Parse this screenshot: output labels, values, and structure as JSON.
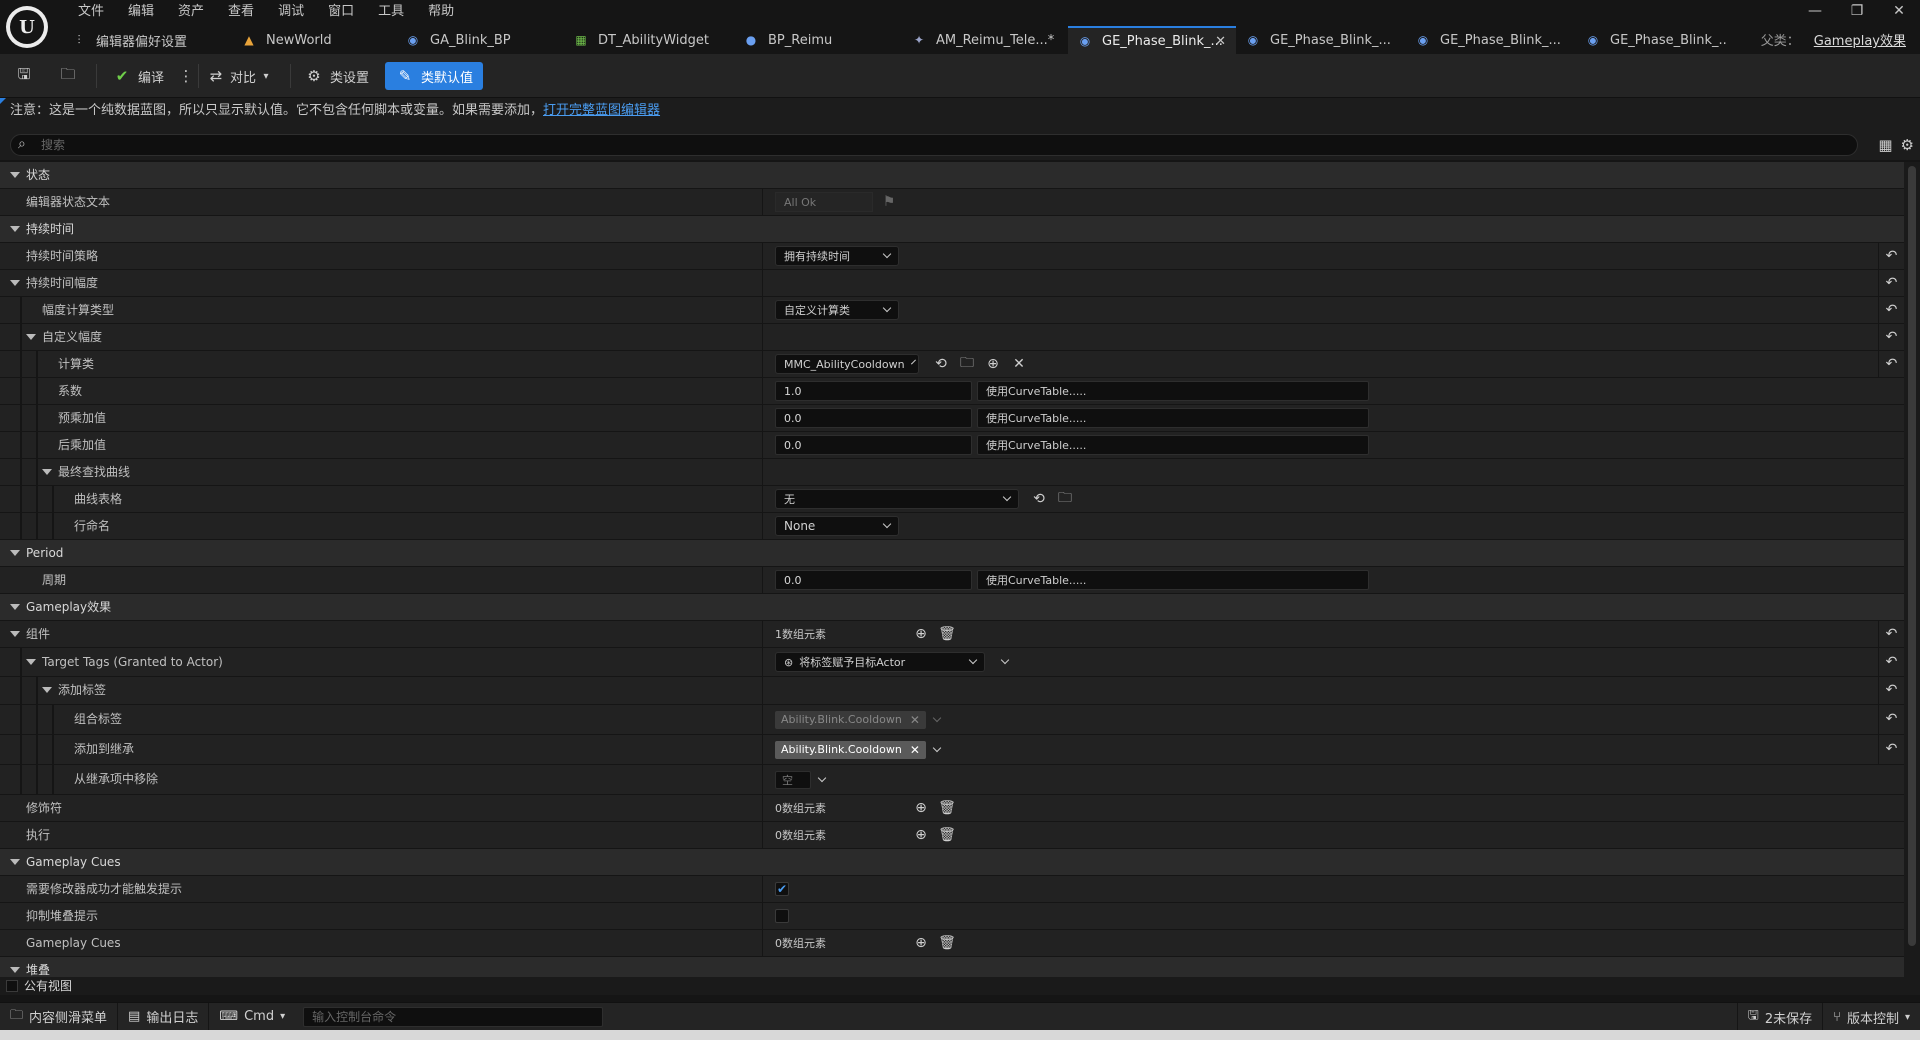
{
  "menu": [
    "文件",
    "编辑",
    "资产",
    "查看",
    "调试",
    "窗口",
    "工具",
    "帮助"
  ],
  "window_controls": [
    "—",
    "❐",
    "✕"
  ],
  "tabs": [
    {
      "label": "编辑器偏好设置",
      "icon": "sliders-icon",
      "glyph": "⫶"
    },
    {
      "label": "NewWorld",
      "icon": "level-icon",
      "glyph": "▲"
    },
    {
      "label": "GA_Blink_BP",
      "icon": "blueprint-icon",
      "glyph": "◉"
    },
    {
      "label": "DT_AbilityWidget",
      "icon": "datatable-icon",
      "glyph": "▦"
    },
    {
      "label": "BP_Reimu",
      "icon": "character-icon",
      "glyph": "●"
    },
    {
      "label": "AM_Reimu_Tele...*",
      "icon": "montage-icon",
      "glyph": "✦"
    },
    {
      "label": "GE_Phase_Blink_...",
      "icon": "blueprint-icon",
      "glyph": "◉",
      "active": true
    },
    {
      "label": "GE_Phase_Blink_...",
      "icon": "blueprint-icon",
      "glyph": "◉"
    },
    {
      "label": "GE_Phase_Blink_...",
      "icon": "blueprint-icon",
      "glyph": "◉"
    },
    {
      "label": "GE_Phase_Blink_...",
      "icon": "blueprint-icon",
      "glyph": "◉"
    }
  ],
  "tab_close": "✕",
  "parent_class": {
    "label": "父类：",
    "value": "Gameplay效果"
  },
  "toolbar": {
    "compile": "编译",
    "diff": "对比",
    "class_settings": "类设置",
    "class_defaults": "类默认值"
  },
  "notice": {
    "text": "注意：这是一个纯数据蓝图，所以只显示默认值。它不包含任何脚本或变量。如果需要添加，",
    "link": "打开完整蓝图编辑器"
  },
  "search": {
    "placeholder": "搜索"
  },
  "rows": {
    "status_cat": "状态",
    "editor_status_text": "编辑器状态文本",
    "editor_status_value": "All Ok",
    "duration_cat": "持续时间",
    "duration_policy": "持续时间策略",
    "duration_policy_value": "拥有持续时间",
    "duration_magnitude": "持续时间幅度",
    "magnitude_calc_type": "幅度计算类型",
    "magnitude_calc_value": "自定义计算类",
    "custom_magnitude": "自定义幅度",
    "calc_class": "计算类",
    "calc_class_value": "MMC_AbilityCooldown",
    "coefficient": "系数",
    "coefficient_value": "1.0",
    "pre_mult": "预乘加值",
    "pre_mult_value": "0.0",
    "post_mult": "后乘加值",
    "post_mult_value": "0.0",
    "curve_option": "使用CurveTable.....",
    "final_lookup": "最终查找曲线",
    "curve_table": "曲线表格",
    "curve_table_value": "无",
    "row_name": "行命名",
    "row_name_value": "None",
    "period_cat": "Period",
    "period": "周期",
    "period_value": "0.0",
    "ge_cat": "Gameplay效果",
    "components": "组件",
    "components_value": "1数组元素",
    "target_tags": "Target Tags (Granted to Actor)",
    "target_tags_value": "将标签赋予目标Actor",
    "add_tags": "添加标签",
    "combined_tags": "组合标签",
    "combined_tags_value": "Ability.Blink.Cooldown",
    "added": "添加到继承",
    "added_value": "Ability.Blink.Cooldown",
    "removed": "从继承项中移除",
    "removed_value": "空",
    "modifiers": "修饰符",
    "modifiers_value": "0数组元素",
    "executions": "执行",
    "executions_value": "0数组元素",
    "cues_cat": "Gameplay Cues",
    "require_modifier": "需要修改器成功才能触发提示",
    "suppress_stacking": "抑制堆叠提示",
    "gameplay_cues": "Gameplay Cues",
    "gameplay_cues_value": "0数组元素",
    "stacking_cat": "堆叠"
  },
  "public_view": "公有视图",
  "bottombar": {
    "content_drawer": "内容侧滑菜单",
    "output_log": "输出日志",
    "cmd": "Cmd",
    "console_placeholder": "输入控制台命令",
    "unsaved": "2未保存",
    "source_control": "版本控制"
  }
}
